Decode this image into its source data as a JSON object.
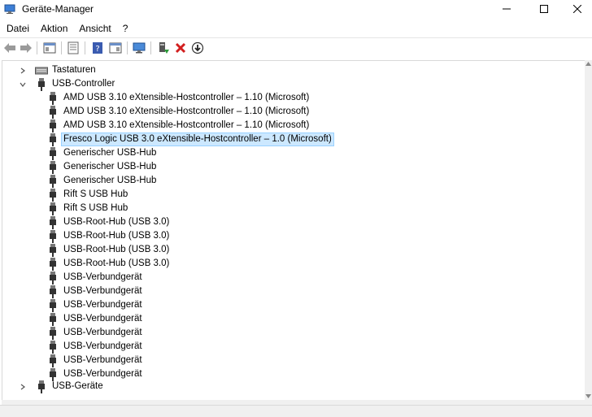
{
  "window": {
    "title": "Geräte-Manager"
  },
  "menu": [
    "Datei",
    "Aktion",
    "Ansicht",
    "?"
  ],
  "toolbar": [
    {
      "name": "back-arrow-icon"
    },
    {
      "name": "forward-arrow-icon"
    },
    {
      "name": "console-tree-icon"
    },
    {
      "name": "properties-icon"
    },
    {
      "name": "help-icon"
    },
    {
      "name": "action-pane-icon"
    },
    {
      "name": "monitor-icon"
    },
    {
      "name": "update-driver-icon"
    },
    {
      "name": "uninstall-device-icon"
    },
    {
      "name": "download-icon"
    }
  ],
  "tree": {
    "tastaturen": "Tastaturen",
    "usb_controller": "USB-Controller",
    "usb_controller_children": [
      "AMD USB 3.10 eXtensible-Hostcontroller – 1.10 (Microsoft)",
      "AMD USB 3.10 eXtensible-Hostcontroller – 1.10 (Microsoft)",
      "AMD USB 3.10 eXtensible-Hostcontroller – 1.10 (Microsoft)",
      "Fresco Logic USB 3.0 eXtensible-Hostcontroller – 1.0 (Microsoft)",
      "Generischer USB-Hub",
      "Generischer USB-Hub",
      "Generischer USB-Hub",
      "Rift S USB Hub",
      "Rift S USB Hub",
      "USB-Root-Hub (USB 3.0)",
      "USB-Root-Hub (USB 3.0)",
      "USB-Root-Hub (USB 3.0)",
      "USB-Root-Hub (USB 3.0)",
      "USB-Verbundgerät",
      "USB-Verbundgerät",
      "USB-Verbundgerät",
      "USB-Verbundgerät",
      "USB-Verbundgerät",
      "USB-Verbundgerät",
      "USB-Verbundgerät",
      "USB-Verbundgerät"
    ],
    "selected_child": "Fresco Logic USB 3.0 eXtensible-Hostcontroller – 1.0 (Microsoft)",
    "usb_geraete": "USB-Geräte"
  }
}
